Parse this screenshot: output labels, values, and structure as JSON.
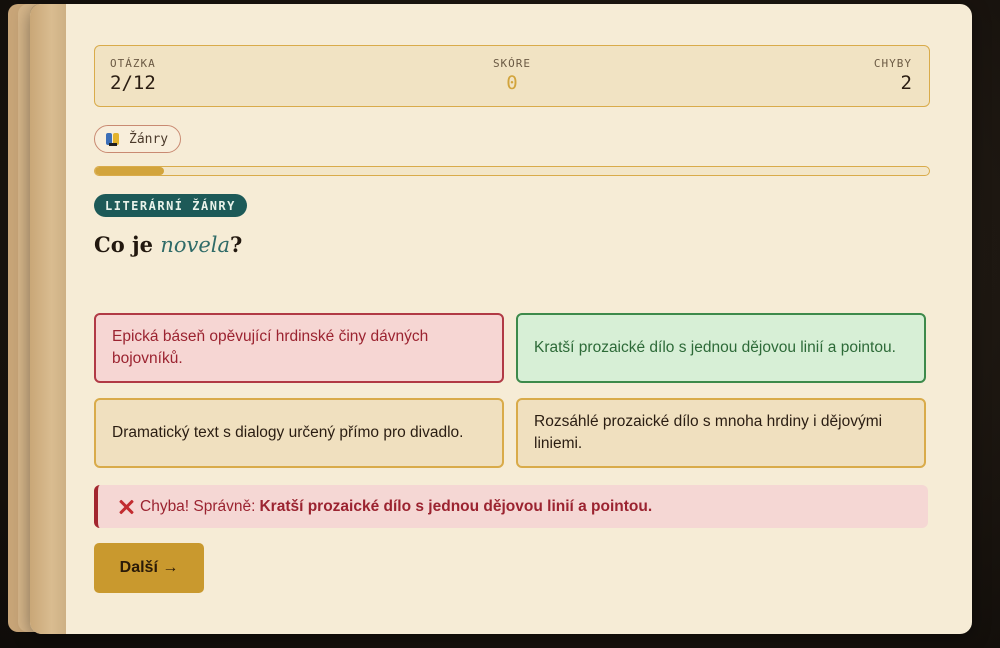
{
  "stats": {
    "question_label": "OTÁZKA",
    "question_value": "2/12",
    "score_label": "SKÓRE",
    "score_value": "0",
    "errors_label": "CHYBY",
    "errors_value": "2"
  },
  "topic_chip": {
    "label": "Žánry",
    "icon": "books-icon"
  },
  "progress": {
    "fraction": 0.083
  },
  "category": "LITERÁRNÍ ŽÁNRY",
  "question": {
    "prefix": "Co je ",
    "term": "novela",
    "suffix": "?"
  },
  "answers": [
    {
      "text": "Epická báseň opěvující hrdinské činy dávných bojovníků.",
      "state": "wrong"
    },
    {
      "text": "Kratší prozaické dílo s jednou dějovou linií a pointou.",
      "state": "correct"
    },
    {
      "text": "Dramatický text s dialogy určený přímo pro divadlo.",
      "state": "neutral"
    },
    {
      "text": "Rozsáhlé prozaické dílo s mnoha hrdiny i dějovými liniemi.",
      "state": "neutral"
    }
  ],
  "feedback": {
    "prefix": "Chyba! Správně:",
    "answer": "Kratší prozaické dílo s jednou dějovou linií a pointou."
  },
  "next_button": "Další →",
  "colors": {
    "accent": "#d2a43c",
    "wrong": "#b13a45",
    "correct": "#3d8a4b",
    "badge": "#1d5a58"
  }
}
